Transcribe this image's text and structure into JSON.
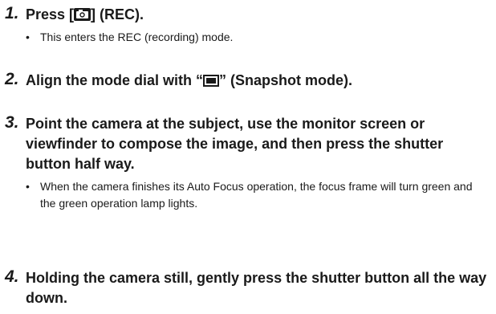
{
  "steps": [
    {
      "number": "1.",
      "heading_before": "Press [",
      "icon": "camera-icon",
      "heading_after": "] (REC).",
      "bullet": "This enters the REC (recording) mode."
    },
    {
      "number": "2.",
      "heading_before": "Align the mode dial with “",
      "icon": "snapshot-mode-icon",
      "heading_after": "” (Snapshot mode)."
    },
    {
      "number": "3.",
      "heading": "Point the camera at the subject, use the monitor screen or viewfinder to compose the image, and then press the shutter button half way.",
      "bullet": "When the camera finishes its Auto Focus operation, the focus frame will turn green and the green operation lamp lights."
    },
    {
      "number": "4.",
      "heading": "Holding the camera still, gently press the shutter button all the way down."
    }
  ],
  "bullet_symbol": "•"
}
